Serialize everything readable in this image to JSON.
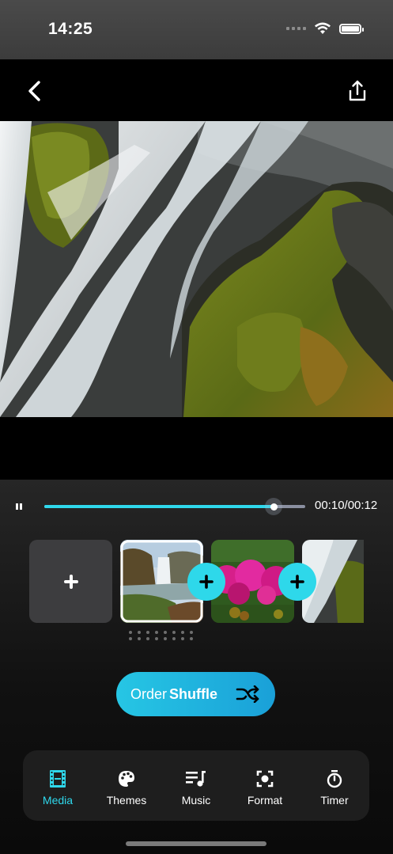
{
  "status": {
    "time": "14:25"
  },
  "player": {
    "time_label": "00:10/00:12",
    "progress": 0.88
  },
  "shuffle": {
    "prefix": "Order",
    "emphasis": "Shuffle"
  },
  "tabs": [
    {
      "label": "Media",
      "icon": "film-icon",
      "active": true
    },
    {
      "label": "Themes",
      "icon": "palette-icon",
      "active": false
    },
    {
      "label": "Music",
      "icon": "music-list-icon",
      "active": false
    },
    {
      "label": "Format",
      "icon": "focus-frame-icon",
      "active": false
    },
    {
      "label": "Timer",
      "icon": "stopwatch-icon",
      "active": false
    }
  ],
  "colors": {
    "accent": "#2fd8ec",
    "panel": "#1e1e1e"
  }
}
